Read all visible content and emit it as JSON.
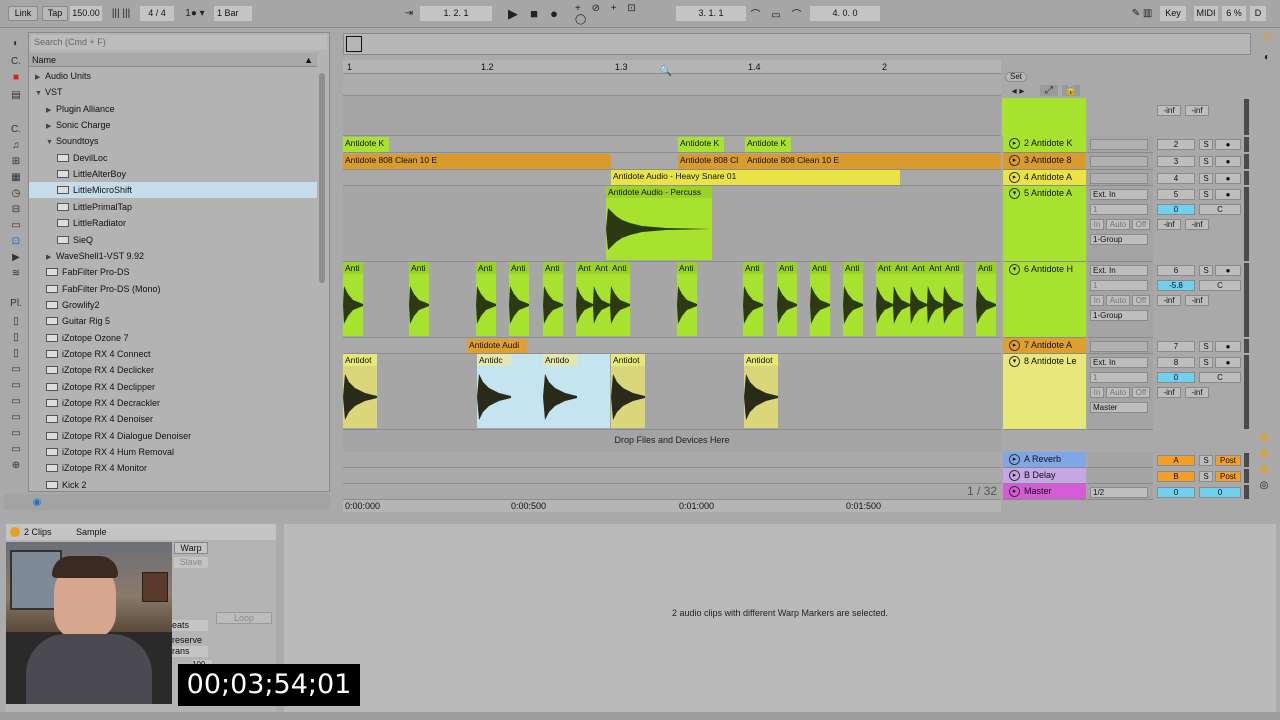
{
  "transport": {
    "link": "Link",
    "tap": "Tap",
    "tempo": "150.00",
    "signature": "4 / 4",
    "quantize": "1 Bar",
    "position": "1.   2.   1",
    "loop_start": "3.   1.   1",
    "loop_length": "4.   0.   0",
    "key": "Key",
    "midi": "MIDI",
    "cpu": "6 %",
    "disk": "D"
  },
  "browser": {
    "search_placeholder": "Search (Cmd + F)",
    "column_name": "Name",
    "cat_labels": {
      "collections": "C.",
      "places": "Pl."
    },
    "items": [
      {
        "label": "Audio Units",
        "indent": 0,
        "tri": "▶"
      },
      {
        "label": "VST",
        "indent": 0,
        "tri": "▼"
      },
      {
        "label": "Plugin Alliance",
        "indent": 1,
        "tri": "▶"
      },
      {
        "label": "Sonic Charge",
        "indent": 1,
        "tri": "▶"
      },
      {
        "label": "Soundtoys",
        "indent": 1,
        "tri": "▼"
      },
      {
        "label": "DevilLoc",
        "indent": 2,
        "plug": true
      },
      {
        "label": "LittleAlterBoy",
        "indent": 2,
        "plug": true
      },
      {
        "label": "LittleMicroShift",
        "indent": 2,
        "plug": true,
        "selected": true
      },
      {
        "label": "LittlePrimalTap",
        "indent": 2,
        "plug": true
      },
      {
        "label": "LittleRadiator",
        "indent": 2,
        "plug": true
      },
      {
        "label": "SieQ",
        "indent": 2,
        "plug": true
      },
      {
        "label": "WaveShell1-VST 9.92",
        "indent": 1,
        "tri": "▶"
      },
      {
        "label": "FabFilter Pro-DS",
        "indent": 1,
        "plug": true
      },
      {
        "label": "FabFilter Pro-DS (Mono)",
        "indent": 1,
        "plug": true
      },
      {
        "label": "Growlify2",
        "indent": 1,
        "plug": true
      },
      {
        "label": "Guitar Rig 5",
        "indent": 1,
        "plug": true
      },
      {
        "label": "iZotope Ozone 7",
        "indent": 1,
        "plug": true
      },
      {
        "label": "iZotope RX 4 Connect",
        "indent": 1,
        "plug": true
      },
      {
        "label": "iZotope RX 4 Declicker",
        "indent": 1,
        "plug": true
      },
      {
        "label": "iZotope RX 4 Declipper",
        "indent": 1,
        "plug": true
      },
      {
        "label": "iZotope RX 4 Decrackler",
        "indent": 1,
        "plug": true
      },
      {
        "label": "iZotope RX 4 Denoiser",
        "indent": 1,
        "plug": true
      },
      {
        "label": "iZotope RX 4 Dialogue Denoiser",
        "indent": 1,
        "plug": true
      },
      {
        "label": "iZotope RX 4 Hum Removal",
        "indent": 1,
        "plug": true
      },
      {
        "label": "iZotope RX 4 Monitor",
        "indent": 1,
        "plug": true
      },
      {
        "label": "Kick 2",
        "indent": 1,
        "plug": true
      }
    ]
  },
  "ruler": {
    "bars": [
      "1",
      "1.2",
      "1.3",
      "1.4",
      "2"
    ],
    "times": [
      "0:00:000",
      "0:00:500",
      "0:01:000",
      "0:01:500"
    ],
    "set": "Set",
    "page": "1 / 32"
  },
  "clips": {
    "k1": "Antidote K",
    "k2": "Antidote K",
    "k3": "Antidote K",
    "clean1": "Antidote 808 Clean 10 E",
    "clean2": "Antidote 808 Cl",
    "clean3": "Antidote 808 Clean 10 E",
    "snare": "Antidote Audio - Heavy Snare 01",
    "perc": "Antidote Audio - Percuss",
    "hat_short": "Anti",
    "hat_shorter": "Ant",
    "orange7": "Antidote Audi",
    "le_short": "Antidot",
    "le_mid": "Antidc",
    "le_mid2": "Antido",
    "drop": "Drop Files and Devices Here",
    "status": "2 audio clips with different Warp Markers are selected."
  },
  "tracks": [
    {
      "name": "2 Antidote K",
      "num": "2",
      "color": "#a6e22e"
    },
    {
      "name": "3 Antidote 8",
      "num": "3",
      "color": "#d99a2e"
    },
    {
      "name": "4 Antidote A",
      "num": "4",
      "color": "#e9e345"
    },
    {
      "name": "5 Antidote A",
      "num": "5",
      "color": "#a6e22e"
    },
    {
      "name": "6 Antidote H",
      "num": "6",
      "color": "#a6e22e"
    },
    {
      "name": "7 Antidote A",
      "num": "7",
      "color": "#e0a030"
    },
    {
      "name": "8 Antidote Le",
      "num": "8",
      "color": "#e6e87a"
    }
  ],
  "returns": [
    {
      "name": "A Reverb",
      "letter": "A",
      "color": "#7fa6e6"
    },
    {
      "name": "B Delay",
      "letter": "B",
      "color": "#c7a6e6"
    },
    {
      "name": "Master",
      "letter": "",
      "color": "#d65bd6"
    }
  ],
  "io": {
    "ext_in": "Ext. In",
    "ch1": "1",
    "in": "In",
    "auto": "Auto",
    "off": "Off",
    "group": "1-Group",
    "master": "Master",
    "master_out": "1/2",
    "inf": "-inf",
    "zero": "0",
    "neg": "-5.8",
    "c": "C",
    "s": "S",
    "post": "Post"
  },
  "clipview": {
    "tab_clips": "2 Clips",
    "tab_sample": "Sample",
    "warp": "Warp",
    "slave": "Slave",
    "loop": "Loop",
    "beats": "eats",
    "preserve": "reserve",
    "trans": "rans",
    "val100": "100"
  },
  "overlay": {
    "timecode": "00;03;54;01"
  }
}
